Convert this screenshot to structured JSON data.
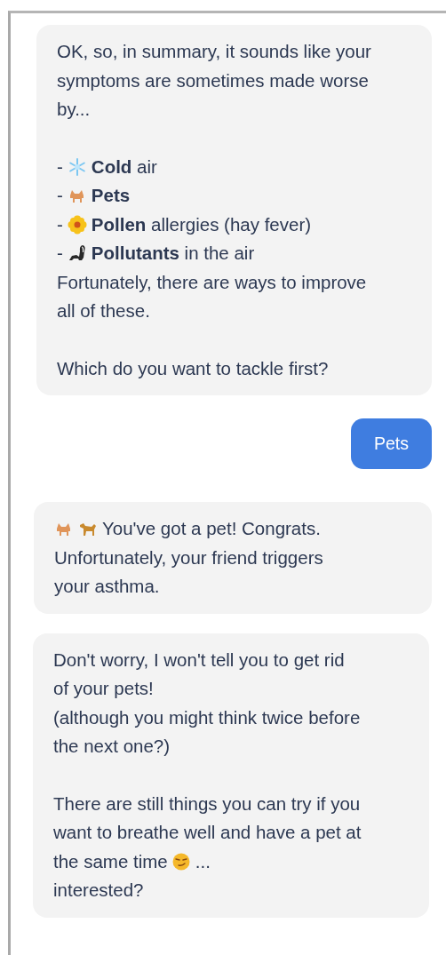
{
  "messages": [
    {
      "kind": "bot",
      "paragraphs": [
        [
          {
            "text": "OK, so, in summary, it sounds like your"
          },
          {
            "text": "symptoms are sometimes made worse"
          },
          {
            "text": "by..."
          }
        ],
        [
          {
            "marker": "-",
            "text": "**Cold** air"
          },
          {
            "marker": "-",
            "text": "**Pets**"
          },
          {
            "marker": "-",
            "text": "**Pollen** allergies (hay fever)"
          },
          {
            "marker": "-",
            "text": "**Pollutants** in the air"
          },
          {
            "text": "Fortunately, there are ways to improve"
          },
          {
            "text": "all of these."
          }
        ],
        [
          {
            "text": "Which do you want to tackle first?"
          }
        ]
      ]
    },
    {
      "kind": "user",
      "text": "Pets"
    },
    {
      "kind": "bot",
      "paragraphs": [
        [
          {
            "text": "You've got a pet! Congrats."
          },
          {
            "text": "Unfortunately, your friend triggers"
          },
          {
            "text": "your asthma."
          }
        ]
      ]
    },
    {
      "kind": "bot",
      "paragraphs": [
        [
          {
            "text": "Don't worry, I won't tell you to get rid"
          },
          {
            "text": "of your pets!"
          },
          {
            "text": "(although you might think twice before"
          },
          {
            "text": "the next one?)"
          }
        ],
        [
          {
            "text": "There are still things you can try if you"
          },
          {
            "text": "want to breathe well and have a pet at"
          },
          {
            "text": "the same time",
            "after": "..."
          },
          {
            "text": "interested?"
          }
        ]
      ]
    }
  ]
}
